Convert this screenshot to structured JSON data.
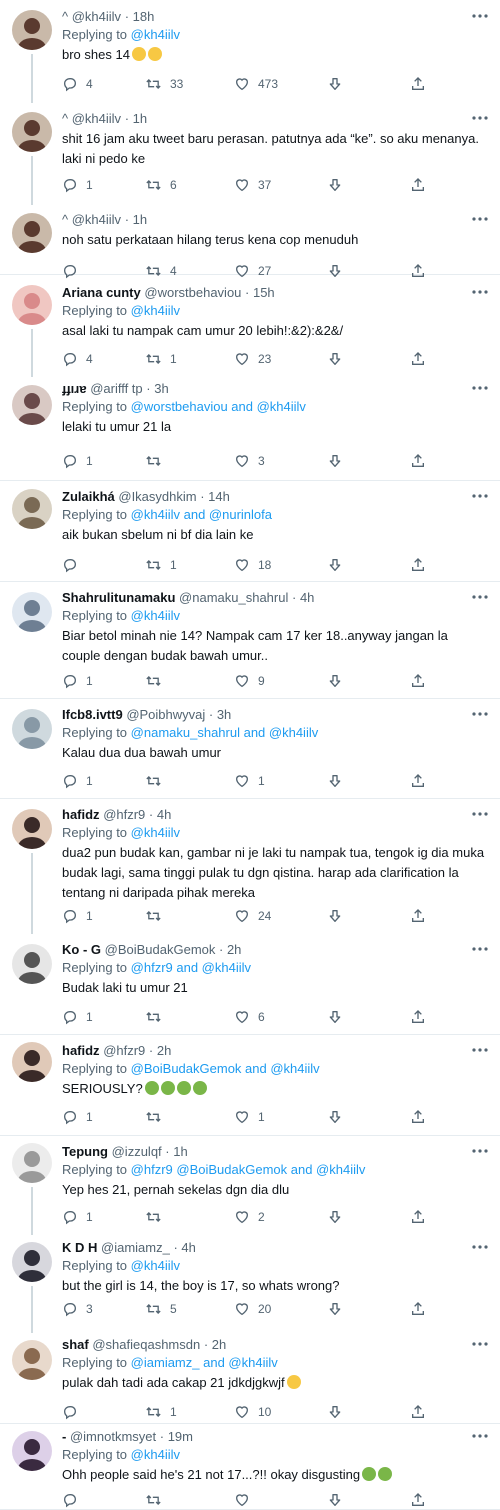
{
  "tweets": [
    {
      "name": "",
      "prefix": "^",
      "handle": "@kh4iilv",
      "time": "· 18h",
      "replying_label": "Replying to",
      "mentions": "@kh4iilv",
      "text": "bro shes 14",
      "emoji": [
        "crying-face",
        "crying-face"
      ],
      "reply": "4",
      "retweet": "33",
      "like": "473",
      "down": ""
    },
    {
      "name": "",
      "prefix": "^",
      "handle": "@kh4iilv",
      "time": "· 1h",
      "replying_label": "",
      "mentions": "",
      "text": "shit 16 jam aku tweet baru perasan. patutnya ada “ke”. so aku menanya. laki ni pedo ke",
      "emoji": [],
      "reply": "1",
      "retweet": "6",
      "like": "37",
      "down": ""
    },
    {
      "name": "",
      "prefix": "^",
      "handle": "@kh4iilv",
      "time": "· 1h",
      "replying_label": "",
      "mentions": "",
      "text": "noh satu perkataan hilang terus kena cop menuduh",
      "emoji": [],
      "reply": "",
      "retweet": "4",
      "like": "27",
      "down": ""
    },
    {
      "name": "Ariana cunty",
      "prefix": "",
      "handle": "@worstbehaviou",
      "time": "· 15h",
      "replying_label": "Replying to",
      "mentions": "@kh4iilv",
      "text": "asal laki tu nampak cam umur 20 lebih!:&2):&2&/",
      "emoji": [],
      "reply": "4",
      "retweet": "1",
      "like": "23",
      "down": ""
    },
    {
      "name": "ɟɟıɹɐ",
      "prefix": "",
      "handle": "@arifff tp",
      "time": "· 3h",
      "replying_label": "Replying to",
      "mentions": "@worstbehaviou and @kh4iilv",
      "text": "lelaki tu umur 21 la",
      "emoji": [],
      "reply": "1",
      "retweet": "",
      "like": "3",
      "down": ""
    },
    {
      "name": "Zulaikhá",
      "prefix": "",
      "handle": "@Ikasydhkim",
      "time": "· 14h",
      "replying_label": "Replying to",
      "mentions": "@kh4iilv and @nurinlofa",
      "text": "aik bukan sbelum ni bf dia lain ke",
      "emoji": [],
      "reply": "",
      "retweet": "1",
      "like": "18",
      "down": ""
    },
    {
      "name": "Shahrulitunamaku",
      "prefix": "",
      "handle": "@namaku_shahrul",
      "time": "· 4h",
      "replying_label": "Replying to",
      "mentions": "@kh4iilv",
      "text": "Biar betol minah nie 14? Nampak cam 17 ker 18..anyway jangan la couple dengan budak bawah umur..",
      "emoji": [],
      "reply": "1",
      "retweet": "",
      "like": "9",
      "down": ""
    },
    {
      "name": "Ifcb8.ivtt9",
      "prefix": "",
      "handle": "@Poibhwyvaj",
      "time": "· 3h",
      "replying_label": "Replying to",
      "mentions": "@namaku_shahrul and @kh4iilv",
      "text": "Kalau dua dua bawah umur",
      "emoji": [],
      "reply": "1",
      "retweet": "",
      "like": "1",
      "down": ""
    },
    {
      "name": "hafidz",
      "prefix": "",
      "handle": "@hfzr9",
      "time": "· 4h",
      "replying_label": "Replying to",
      "mentions": "@kh4iilv",
      "text": "dua2 pun budak kan, gambar ni je laki tu nampak tua, tengok ig dia muka budak lagi, sama tinggi pulak tu dgn qistina. harap ada clarification la tentang ni daripada pihak mereka",
      "emoji": [],
      "reply": "1",
      "retweet": "",
      "like": "24",
      "down": ""
    },
    {
      "name": "Ko - G",
      "prefix": "",
      "handle": "@BoiBudakGemok",
      "time": "· 2h",
      "replying_label": "Replying to",
      "mentions": "@hfzr9 and @kh4iilv",
      "text": "Budak laki tu umur 21",
      "emoji": [],
      "reply": "1",
      "retweet": "",
      "like": "6",
      "down": ""
    },
    {
      "name": "hafidz",
      "prefix": "",
      "handle": "@hfzr9",
      "time": "· 2h",
      "replying_label": "Replying to",
      "mentions": "@BoiBudakGemok and @kh4iilv",
      "text": "SERIOUSLY?",
      "emoji": [
        "nauseated-face",
        "nauseated-face",
        "nauseated-face",
        "nauseated-face"
      ],
      "reply": "1",
      "retweet": "",
      "like": "1",
      "down": ""
    },
    {
      "name": "Tepung",
      "prefix": "",
      "handle": "@izzulqf",
      "time": "· 1h",
      "replying_label": "Replying to",
      "mentions": "@hfzr9 @BoiBudakGemok and @kh4iilv",
      "text": "Yep hes 21, pernah sekelas dgn dia dlu",
      "emoji": [],
      "reply": "1",
      "retweet": "",
      "like": "2",
      "down": ""
    },
    {
      "name": "K D H",
      "prefix": "",
      "handle": "@iamiamz_",
      "time": "· 4h",
      "replying_label": "Replying to",
      "mentions": "@kh4iilv",
      "text": "but the girl is 14, the boy is 17, so whats wrong?",
      "emoji": [],
      "reply": "3",
      "retweet": "5",
      "like": "20",
      "down": ""
    },
    {
      "name": "shaf",
      "prefix": "",
      "handle": "@shafieqashmsdn",
      "time": "· 2h",
      "replying_label": "Replying to",
      "mentions": "@iamiamz_ and @kh4iilv",
      "text": "pulak dah tadi ada cakap 21 jdkdjgkwjf",
      "emoji": [
        "crying-face"
      ],
      "reply": "",
      "retweet": "1",
      "like": "10",
      "down": ""
    },
    {
      "name": "-",
      "prefix": "",
      "handle": "@imnotkmsyet",
      "time": "· 19m",
      "replying_label": "Replying to",
      "mentions": "@kh4iilv",
      "text": "Ohh people said he's 21 not 17...?!! okay disgusting",
      "emoji": [
        "nauseated-face",
        "nauseated-face"
      ],
      "reply": "",
      "retweet": "",
      "like": "",
      "down": ""
    }
  ],
  "colors": {
    "accent": "#1d9bf0",
    "muted": "#536471",
    "text": "#0f1419",
    "divider": "#e6ecf0"
  },
  "icons": [
    "reply-icon",
    "retweet-icon",
    "like-icon",
    "downvote-icon",
    "share-icon",
    "more-icon"
  ]
}
